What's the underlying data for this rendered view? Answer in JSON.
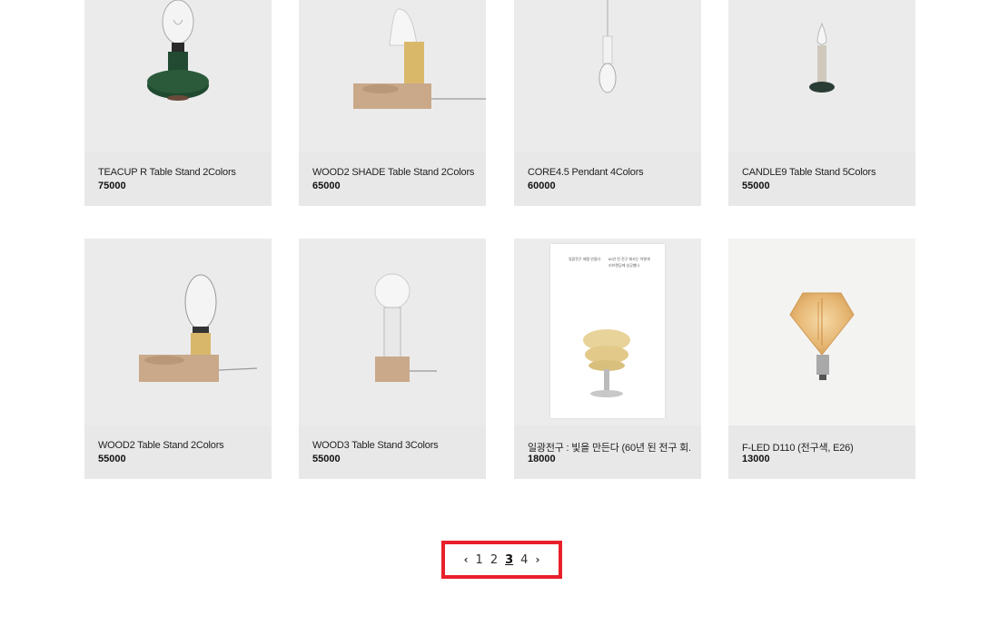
{
  "products": [
    {
      "name": "TEACUP R Table Stand 2Colors",
      "price": "75000"
    },
    {
      "name": "WOOD2 SHADE Table Stand 2Colors",
      "price": "65000"
    },
    {
      "name": "CORE4.5 Pendant 4Colors",
      "price": "60000"
    },
    {
      "name": "CANDLE9 Table Stand 5Colors",
      "price": "55000"
    },
    {
      "name": "WOOD2 Table Stand 2Colors",
      "price": "55000"
    },
    {
      "name": "WOOD3 Table Stand 3Colors",
      "price": "55000"
    },
    {
      "name": "일광전구 : 빛을 만든다 (60년 된 전구 회...",
      "price": "18000"
    },
    {
      "name": "F-LED D110 (전구색, E26)",
      "price": "13000"
    }
  ],
  "book_cover": {
    "line1": "일광전구 제절 안들다",
    "line2": "60년 된 전구 회사는 어떻게",
    "line3": "리브랜딩에 성공했나"
  },
  "pagination": {
    "prev": "‹",
    "pages": [
      "1",
      "2",
      "3",
      "4"
    ],
    "current": "3",
    "next": "›"
  }
}
